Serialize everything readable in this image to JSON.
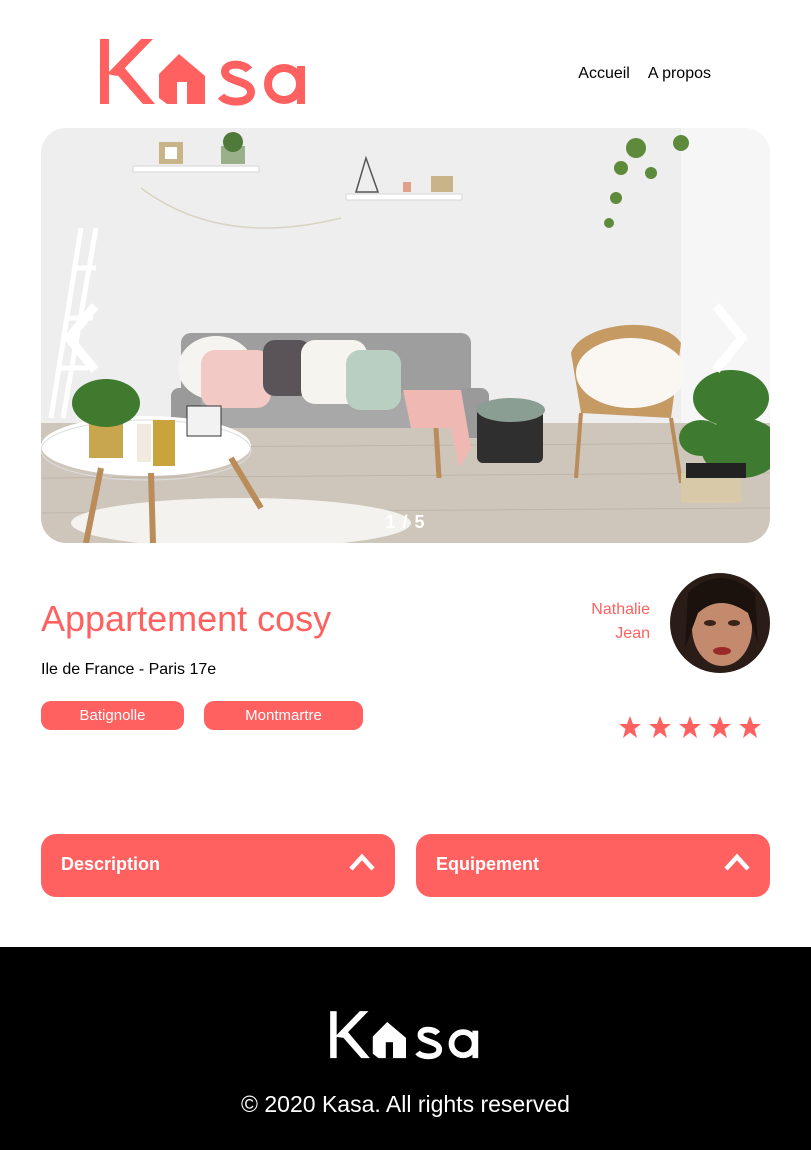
{
  "app": {
    "logo_text": "Kasa",
    "brand_color": "#FF6060"
  },
  "nav": {
    "items": [
      {
        "label": "Accueil"
      },
      {
        "label": "A propos"
      }
    ]
  },
  "gallery": {
    "counter": "1 / 5",
    "prev_icon": "chevron-left-icon",
    "next_icon": "chevron-right-icon"
  },
  "listing": {
    "title": "Appartement cosy",
    "location": "Ile de France - Paris 17e",
    "tags": [
      "Batignolle",
      "Montmartre"
    ],
    "host": {
      "first_name": "Nathalie",
      "last_name": "Jean"
    },
    "rating": 5,
    "rating_max": 5
  },
  "collapses": [
    {
      "label": "Description",
      "icon": "chevron-up-icon"
    },
    {
      "label": "Equipement",
      "icon": "chevron-up-icon"
    }
  ],
  "footer": {
    "copyright": "© 2020 Kasa. All rights reserved"
  }
}
